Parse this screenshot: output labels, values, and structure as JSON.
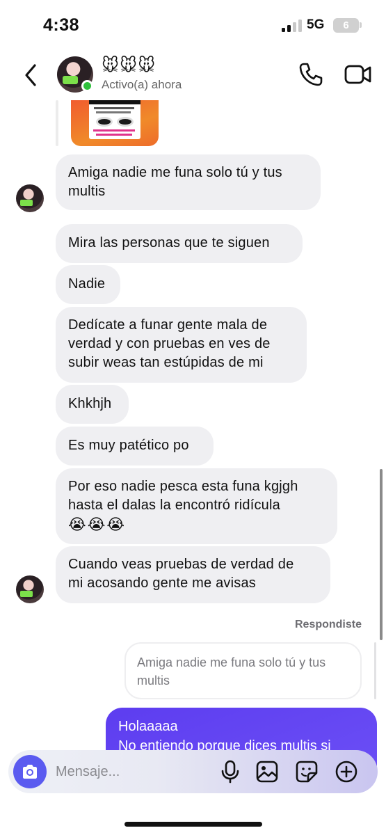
{
  "status_bar": {
    "time": "4:38",
    "network": "5G",
    "battery": "6"
  },
  "header": {
    "contact_name": "🐭🐭🐭",
    "contact_status": "Activo(a) ahora",
    "icons": [
      "back-chevron-icon",
      "phone-icon",
      "video-camera-icon"
    ]
  },
  "messages": [
    {
      "text": "Amiga nadie me funa solo tú y tus\nmultis"
    },
    {
      "text": "Mira las personas que te siguen"
    },
    {
      "text": "Nadie"
    },
    {
      "text": "Dedícate a funar gente mala de\nverdad y con pruebas en ves de\nsubir weas tan estúpidas  de mi"
    },
    {
      "text": "Khkhjh"
    },
    {
      "text": "Es muy patético po"
    },
    {
      "text": "Por eso nadie pesca esta funa kgjgh\nhasta el dalas la encontró ridícula",
      "emoji": "😭😭😭"
    },
    {
      "text": "Cuando veas pruebas de verdad de\nmi acosando gente me avisas"
    }
  ],
  "reply": {
    "label": "Respondiste",
    "quoted_text": "Amiga nadie me funa solo tú y tus\nmultis"
  },
  "sent_message": {
    "text": "Holaaaaa\nNo entiendo porque dices multis si"
  },
  "composer": {
    "placeholder": "Mensaje...",
    "icons": [
      "camera-icon",
      "microphone-icon",
      "image-icon",
      "sticker-icon",
      "plus-icon"
    ]
  },
  "colors": {
    "received_bubble": "#efeff2",
    "sent_bubble": "#5d3df0",
    "camera_button": "#5b5bf0",
    "online_indicator": "#2fc03c"
  }
}
